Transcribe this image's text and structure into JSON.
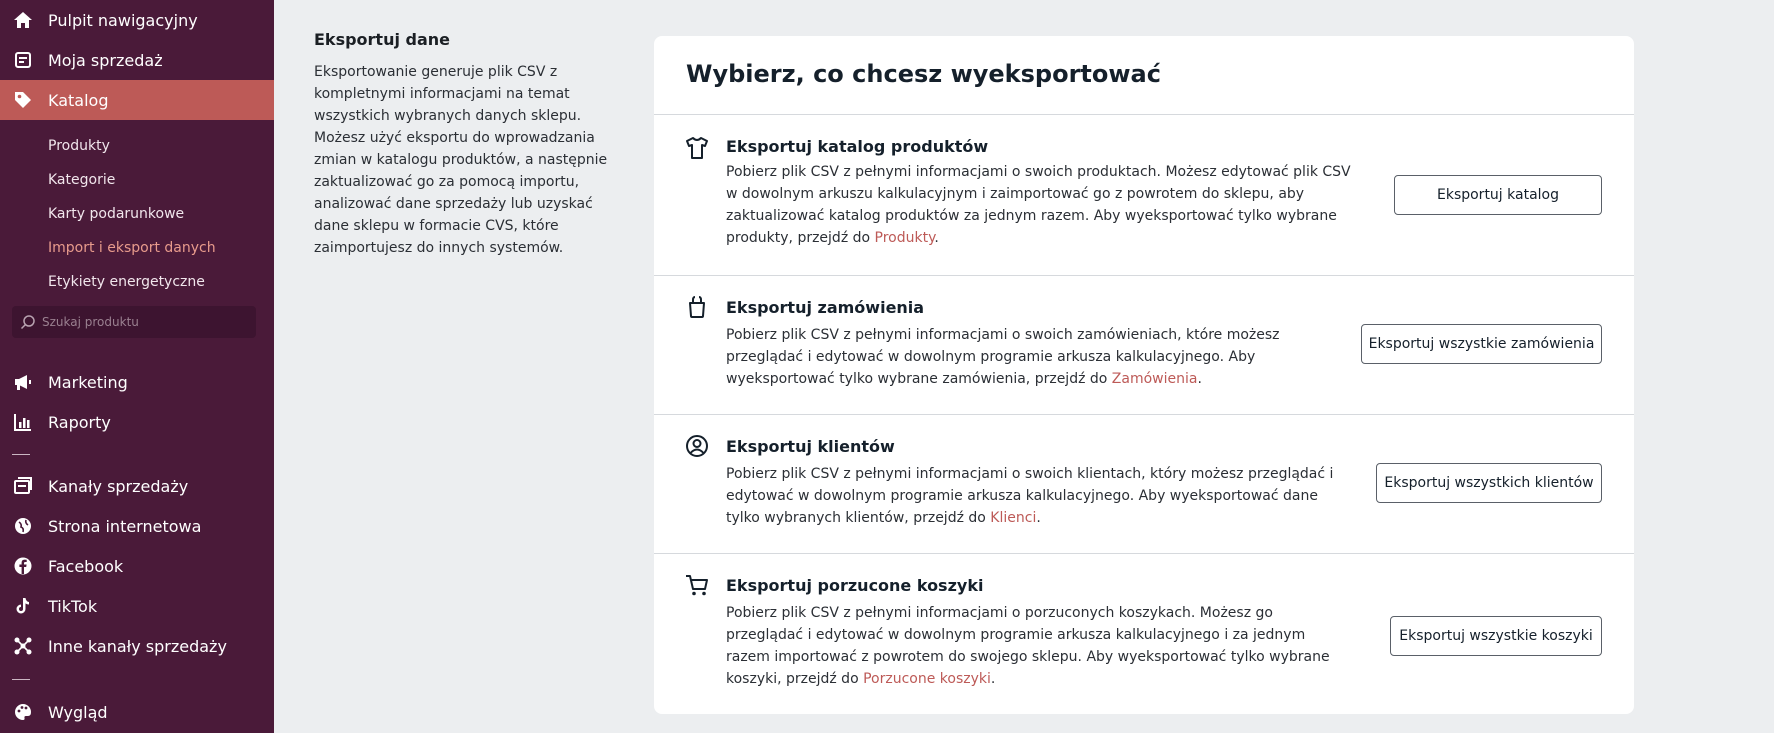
{
  "sidebar": {
    "top_items": [
      {
        "label": "Pulpit nawigacyjny",
        "icon": "home-icon"
      },
      {
        "label": "Moja sprzedaż",
        "icon": "sales-icon"
      },
      {
        "label": "Katalog",
        "icon": "tag-icon",
        "active": true
      }
    ],
    "sub_items": [
      {
        "label": "Produkty"
      },
      {
        "label": "Kategorie"
      },
      {
        "label": "Karty podarunkowe"
      },
      {
        "label": "Import i eksport danych",
        "active": true
      },
      {
        "label": "Etykiety energetyczne"
      }
    ],
    "search": {
      "placeholder": "Szukaj produktu"
    },
    "mid_items": [
      {
        "label": "Marketing",
        "icon": "megaphone-icon"
      },
      {
        "label": "Raporty",
        "icon": "chart-icon"
      }
    ],
    "channel_items": [
      {
        "label": "Kanały sprzedaży",
        "icon": "channels-icon"
      },
      {
        "label": "Strona internetowa",
        "icon": "globe-icon"
      },
      {
        "label": "Facebook",
        "icon": "facebook-icon"
      },
      {
        "label": "TikTok",
        "icon": "tiktok-icon"
      },
      {
        "label": "Inne kanały sprzedaży",
        "icon": "network-icon"
      }
    ],
    "bottom_items": [
      {
        "label": "Wygląd",
        "icon": "palette-icon"
      }
    ]
  },
  "intro": {
    "title": "Eksportuj dane",
    "text": "Eksportowanie generuje plik CSV z kompletnymi informacjami na temat wszystkich wybranych danych sklepu. Możesz użyć eksportu do wprowadzania zmian w katalogu produktów, a następnie zaktualizować go za pomocą importu, analizować dane sprzedaży lub uzyskać dane sklepu w formacie CVS, które zaimportujesz do innych systemów."
  },
  "card": {
    "title": "Wybierz, co chcesz wyeksportować",
    "sections": [
      {
        "icon": "tshirt-icon",
        "title": "Eksportuj katalog produktów",
        "desc": "Pobierz plik CSV z pełnymi informacjami o swoich produktach. Możesz edytować plik CSV w dowolnym arkuszu kalkulacyjnym i zaimportować go z powrotem do sklepu, aby zaktualizować katalog produktów za jednym razem. Aby wyeksportować tylko wybrane produkty, przejdź do ",
        "link": "Produkty",
        "suffix": ".",
        "button": "Eksportuj katalog"
      },
      {
        "icon": "bag-icon",
        "title": "Eksportuj zamówienia",
        "desc": "Pobierz plik CSV z pełnymi informacjami o swoich zamówieniach, które możesz przeglądać i edytować w dowolnym programie arkusza kalkulacyjnego. Aby wyeksportować tylko wybrane zamówienia, przejdź do ",
        "link": "Zamówienia",
        "suffix": ".",
        "button": "Eksportuj wszystkie zamówienia"
      },
      {
        "icon": "user-circle-icon",
        "title": "Eksportuj klientów",
        "desc": "Pobierz plik CSV z pełnymi informacjami o swoich klientach, który możesz przeglądać i edytować w dowolnym programie arkusza kalkulacyjnego. Aby wyeksportować dane tylko wybranych klientów, przejdź do ",
        "link": "Klienci",
        "suffix": ".",
        "button": "Eksportuj wszystkich klientów"
      },
      {
        "icon": "cart-icon",
        "title": "Eksportuj porzucone koszyki",
        "desc": "Pobierz plik CSV z pełnymi informacjami o porzuconych koszykach. Możesz go przeglądać i edytować w dowolnym programie arkusza kalkulacyjnego i za jednym razem importować z powrotem do swojego sklepu. Aby wyeksportować tylko wybrane koszyki, przejdź do ",
        "link": "Porzucone koszyki",
        "suffix": ".",
        "button": "Eksportuj wszystkie koszyki"
      }
    ]
  },
  "colors": {
    "sidebar_bg": "#4a1a39",
    "active_bg": "#bd5a57",
    "link": "#bd5a57"
  }
}
